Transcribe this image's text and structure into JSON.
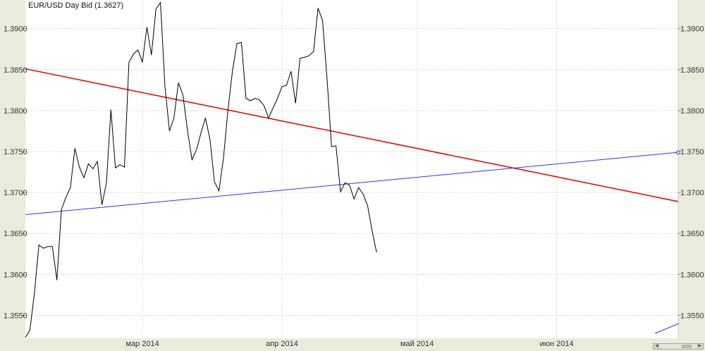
{
  "chart_data": {
    "type": "line",
    "title": "EUR/USD Day Bid (1.3627)",
    "ylim": [
      1.3522,
      1.3935
    ],
    "y_ticks": [
      "1.3550",
      "1.3600",
      "1.3650",
      "1.3700",
      "1.3750",
      "1.3800",
      "1.3850",
      "1.3900"
    ],
    "x_axis": {
      "start": "2014-02-03",
      "end": "2014-06-28",
      "tick_labels": [
        {
          "date": "2014-03-01",
          "label": "мар 2014"
        },
        {
          "date": "2014-04-01",
          "label": "апр 2014"
        },
        {
          "date": "2014-05-01",
          "label": "май 2014"
        },
        {
          "date": "2014-06-01",
          "label": "июн 2014"
        }
      ]
    },
    "grid": {
      "horizontal": true,
      "vertical": true
    },
    "series": [
      {
        "color": "#000000",
        "points": [
          [
            "2014-02-03",
            1.3523
          ],
          [
            "2014-02-04",
            1.3532
          ],
          [
            "2014-02-05",
            1.3577
          ],
          [
            "2014-02-06",
            1.3636
          ],
          [
            "2014-02-07",
            1.3632
          ],
          [
            "2014-02-08",
            1.3634
          ],
          [
            "2014-02-09",
            1.3634
          ],
          [
            "2014-02-10",
            1.3593
          ],
          [
            "2014-02-11",
            1.3679
          ],
          [
            "2014-02-12",
            1.3694
          ],
          [
            "2014-02-13",
            1.3706
          ],
          [
            "2014-02-14",
            1.3754
          ],
          [
            "2014-02-15",
            1.3731
          ],
          [
            "2014-02-16",
            1.3718
          ],
          [
            "2014-02-17",
            1.3735
          ],
          [
            "2014-02-18",
            1.3729
          ],
          [
            "2014-02-19",
            1.3738
          ],
          [
            "2014-02-20",
            1.3685
          ],
          [
            "2014-02-21",
            1.3712
          ],
          [
            "2014-02-22",
            1.3801
          ],
          [
            "2014-02-23",
            1.373
          ],
          [
            "2014-02-24",
            1.3734
          ],
          [
            "2014-02-25",
            1.3731
          ],
          [
            "2014-02-26",
            1.3859
          ],
          [
            "2014-02-27",
            1.3869
          ],
          [
            "2014-02-28",
            1.3874
          ],
          [
            "2014-03-01",
            1.3859
          ],
          [
            "2014-03-02",
            1.3902
          ],
          [
            "2014-03-03",
            1.3868
          ],
          [
            "2014-03-04",
            1.3924
          ],
          [
            "2014-03-05",
            1.3932
          ],
          [
            "2014-03-06",
            1.3829
          ],
          [
            "2014-03-07",
            1.3775
          ],
          [
            "2014-03-08",
            1.3791
          ],
          [
            "2014-03-09",
            1.3834
          ],
          [
            "2014-03-10",
            1.3819
          ],
          [
            "2014-03-11",
            1.3776
          ],
          [
            "2014-03-12",
            1.374
          ],
          [
            "2014-03-13",
            1.3752
          ],
          [
            "2014-03-14",
            1.3773
          ],
          [
            "2014-03-15",
            1.3791
          ],
          [
            "2014-03-16",
            1.3765
          ],
          [
            "2014-03-17",
            1.3713
          ],
          [
            "2014-03-18",
            1.3702
          ],
          [
            "2014-03-19",
            1.3742
          ],
          [
            "2014-03-20",
            1.3801
          ],
          [
            "2014-03-21",
            1.3849
          ],
          [
            "2014-03-22",
            1.3882
          ],
          [
            "2014-03-23",
            1.3883
          ],
          [
            "2014-03-24",
            1.3815
          ],
          [
            "2014-03-25",
            1.3812
          ],
          [
            "2014-03-26",
            1.3815
          ],
          [
            "2014-03-27",
            1.3813
          ],
          [
            "2014-03-28",
            1.3806
          ],
          [
            "2014-03-29",
            1.3791
          ],
          [
            "2014-03-30",
            1.3803
          ],
          [
            "2014-03-31",
            1.3815
          ],
          [
            "2014-04-01",
            1.3829
          ],
          [
            "2014-04-02",
            1.3831
          ],
          [
            "2014-04-03",
            1.3848
          ],
          [
            "2014-04-04",
            1.3809
          ],
          [
            "2014-04-05",
            1.3864
          ],
          [
            "2014-04-06",
            1.3865
          ],
          [
            "2014-04-07",
            1.3867
          ],
          [
            "2014-04-08",
            1.3872
          ],
          [
            "2014-04-09",
            1.3925
          ],
          [
            "2014-04-10",
            1.391
          ],
          [
            "2014-04-11",
            1.3839
          ],
          [
            "2014-04-12",
            1.3756
          ],
          [
            "2014-04-13",
            1.3757
          ],
          [
            "2014-04-14",
            1.3701
          ],
          [
            "2014-04-15",
            1.3712
          ],
          [
            "2014-04-16",
            1.3709
          ],
          [
            "2014-04-17",
            1.3692
          ],
          [
            "2014-04-18",
            1.3706
          ],
          [
            "2014-04-19",
            1.3698
          ],
          [
            "2014-04-20",
            1.3684
          ],
          [
            "2014-04-21",
            1.3654
          ],
          [
            "2014-04-22",
            1.3627
          ]
        ]
      }
    ],
    "trendlines": [
      {
        "color": "#e01010",
        "from": [
          "2014-02-03",
          1.3851
        ],
        "to": [
          "2014-06-28",
          1.3689
        ]
      },
      {
        "color": "#3333ee",
        "from": [
          "2014-02-03",
          1.3673
        ],
        "to": [
          "2014-06-28",
          1.3749
        ]
      }
    ]
  }
}
